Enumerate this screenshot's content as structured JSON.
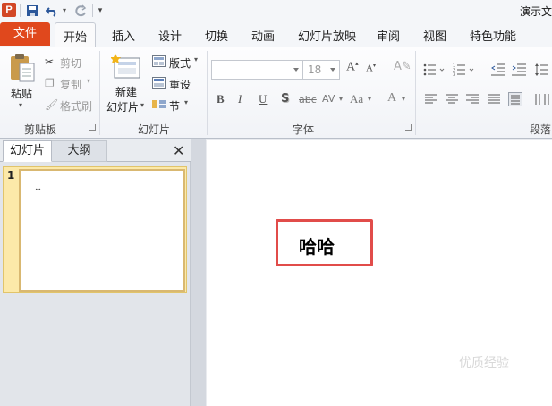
{
  "app": {
    "icon_letter": "P",
    "title": "演示文"
  },
  "quick_access": {
    "save_icon": "save-icon",
    "undo_icon": "undo-icon",
    "redo_icon": "redo-icon",
    "customize_icon": "customize-qat-icon"
  },
  "tabs": {
    "file": "文件",
    "items": [
      "开始",
      "插入",
      "设计",
      "切换",
      "动画",
      "幻灯片放映",
      "审阅",
      "视图",
      "特色功能"
    ]
  },
  "ribbon": {
    "clipboard": {
      "paste": "粘贴",
      "cut": "剪切",
      "copy": "复制",
      "format_painter": "格式刷",
      "label": "剪贴板"
    },
    "slides": {
      "new_line1": "新建",
      "new_line2": "幻灯片",
      "layout": "版式",
      "reset": "重设",
      "section": "节",
      "label": "幻灯片"
    },
    "font": {
      "font_name": "",
      "font_size": "18",
      "label": "字体",
      "buttons": [
        "B",
        "I",
        "U",
        "S",
        "abc",
        "AV",
        "Aa",
        "A"
      ]
    },
    "paragraph": {
      "label": "段落"
    }
  },
  "left_panel": {
    "tab_slides": "幻灯片",
    "tab_outline": "大纲",
    "close": "✕",
    "slide_number": "1",
    "thumb_text": "••"
  },
  "slide": {
    "text": "哈哈"
  },
  "watermark": "优质经验"
}
